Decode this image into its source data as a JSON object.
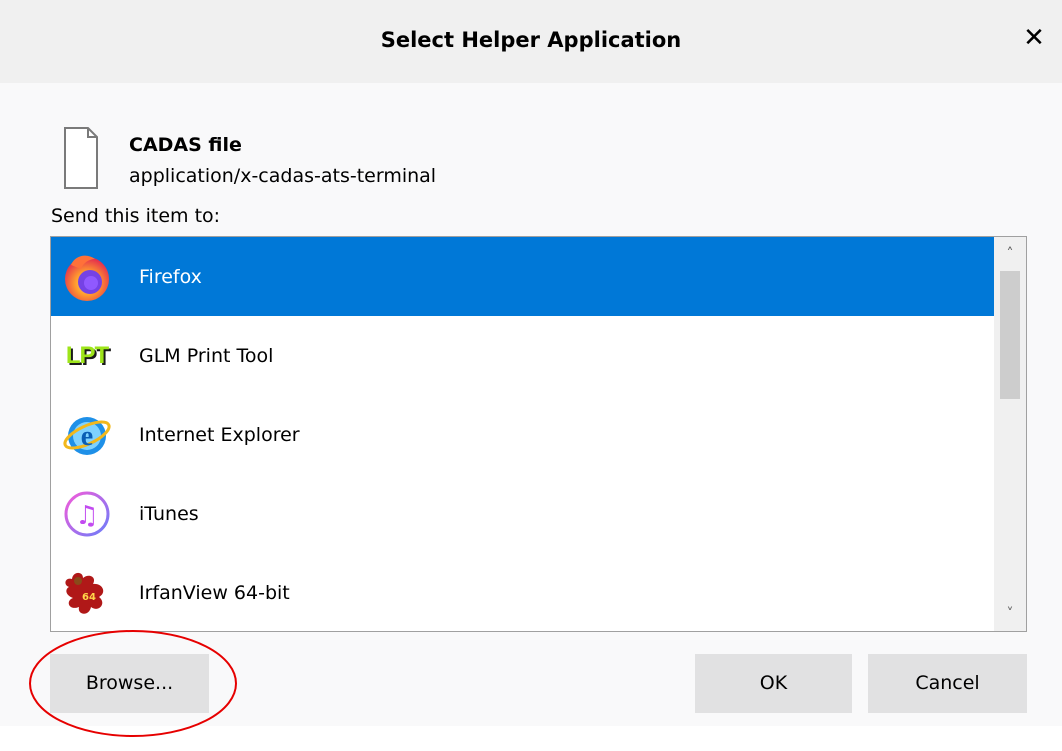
{
  "dialog": {
    "title": "Select Helper Application",
    "close_symbol": "✕"
  },
  "file": {
    "icon": "document-icon",
    "name": "CADAS file",
    "mime_type": "application/x-cadas-ats-terminal"
  },
  "send_label": "Send this item to:",
  "apps": [
    {
      "label": "Firefox",
      "icon": "firefox-icon",
      "selected": true
    },
    {
      "label": "GLM Print Tool",
      "icon": "lpt-icon",
      "icon_text": "LPT",
      "selected": false
    },
    {
      "label": "Internet Explorer",
      "icon": "internet-explorer-icon",
      "icon_text": "e",
      "selected": false
    },
    {
      "label": "iTunes",
      "icon": "itunes-icon",
      "icon_text": "♫",
      "selected": false
    },
    {
      "label": "IrfanView 64-bit",
      "icon": "irfanview-icon",
      "icon_text": "64",
      "selected": false
    }
  ],
  "scrollbar": {
    "up": "˄",
    "down": "˅"
  },
  "buttons": {
    "browse": "Browse...",
    "ok": "OK",
    "cancel": "Cancel"
  },
  "colors": {
    "selection": "#0078d7",
    "button_bg": "#e1e1e2",
    "annotation": "#e60000"
  }
}
